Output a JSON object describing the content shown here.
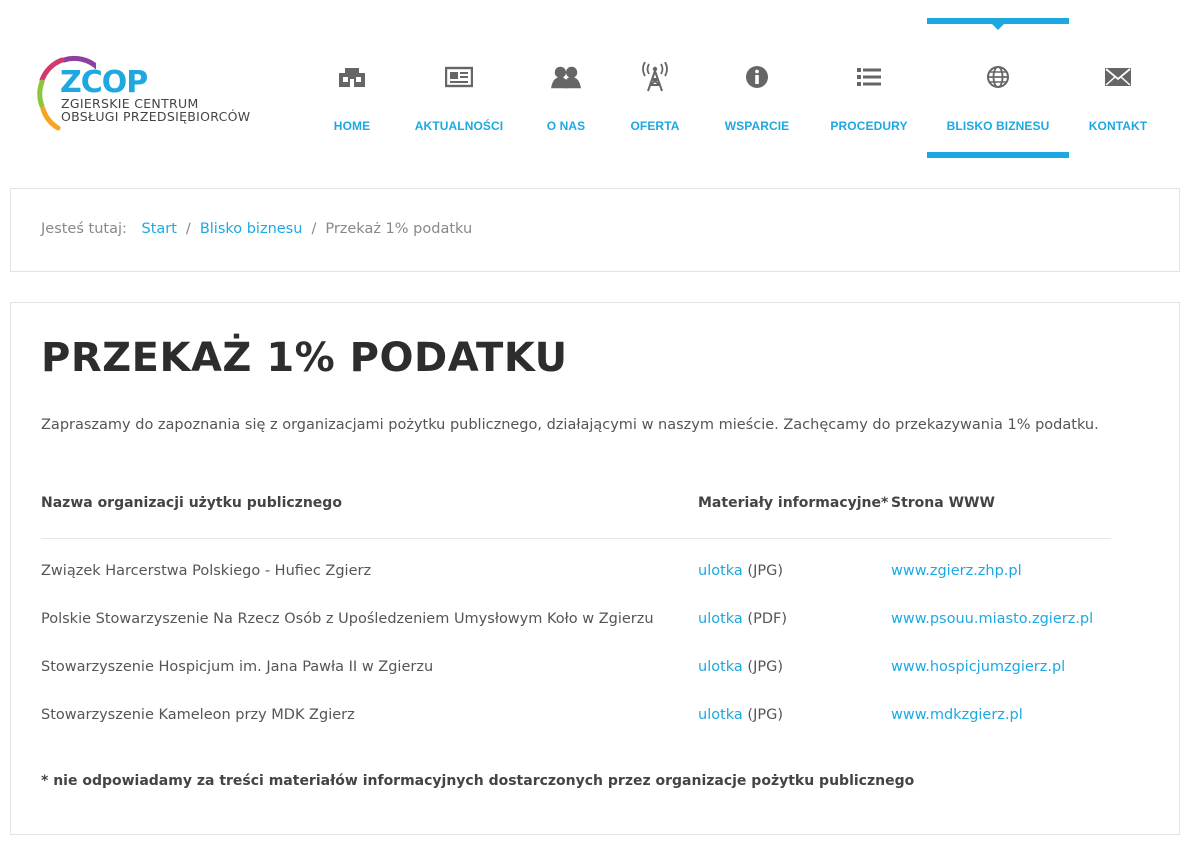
{
  "brand": {
    "logo_mark": "ZCOP",
    "logo_line1": "ZGIERSKIE CENTRUM",
    "logo_line2": "OBSŁUGI PRZEDSIĘBIORCÓW",
    "accent_color": "#1ea8e2"
  },
  "nav": {
    "items": [
      {
        "label": "HOME",
        "icon": "home-icon",
        "active": false
      },
      {
        "label": "AKTUALNOŚCI",
        "icon": "newspaper-icon",
        "active": false
      },
      {
        "label": "O NAS",
        "icon": "people-icon",
        "active": false
      },
      {
        "label": "OFERTA",
        "icon": "antenna-icon",
        "active": false
      },
      {
        "label": "WSPARCIE",
        "icon": "info-icon",
        "active": false
      },
      {
        "label": "PROCEDURY",
        "icon": "list-icon",
        "active": false
      },
      {
        "label": "BLISKO BIZNESU",
        "icon": "globe-icon",
        "active": true
      },
      {
        "label": "KONTAKT",
        "icon": "envelope-icon",
        "active": false
      }
    ]
  },
  "breadcrumb": {
    "prefix": "Jesteś tutaj:",
    "items": [
      "Start",
      "Blisko biznesu",
      "Przekaż 1% podatku"
    ],
    "separator": "/"
  },
  "page": {
    "title": "PRZEKAŻ 1% PODATKU",
    "intro": "Zapraszamy do zapoznania się z organizacjami pożytku publicznego, działającymi w naszym mieście. Zachęcamy do przekazywania 1% podatku."
  },
  "table": {
    "headers": [
      "Nazwa organizacji użytku publicznego",
      "Materiały informacyjne*",
      "Strona WWW"
    ],
    "rows": [
      {
        "name": "Związek Harcerstwa Polskiego - Hufiec Zgierz",
        "material_link": "ulotka",
        "material_format": "(JPG)",
        "website": "www.zgierz.zhp.pl"
      },
      {
        "name": "Polskie Stowarzyszenie Na Rzecz Osób z Upośledzeniem Umysłowym Koło w Zgierzu",
        "material_link": "ulotka",
        "material_format": "(PDF)",
        "website": "www.psouu.miasto.zgierz.pl"
      },
      {
        "name": "Stowarzyszenie Hospicjum im. Jana Pawła II w Zgierzu",
        "material_link": "ulotka",
        "material_format": "(JPG)",
        "website": "www.hospicjumzgierz.pl"
      },
      {
        "name": "Stowarzyszenie Kameleon przy MDK Zgierz",
        "material_link": "ulotka",
        "material_format": "(JPG)",
        "website": "www.mdkzgierz.pl"
      }
    ]
  },
  "footnote": "* nie odpowiadamy za treści materiałów informacyjnych dostarczonych przez organizacje pożytku publicznego"
}
